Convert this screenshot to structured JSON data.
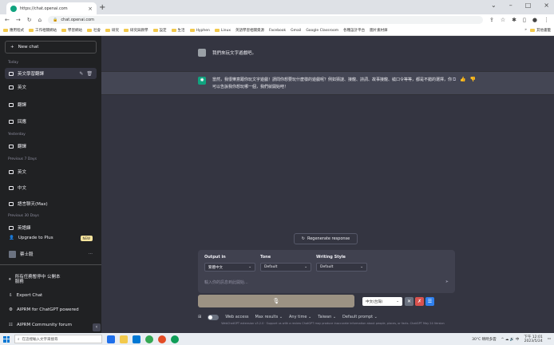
{
  "browser": {
    "tab_title": "https://chat.openai.com",
    "url": "chat.openai.com",
    "bookmarks": [
      "應用程式",
      "工作相關網站",
      "學習網站",
      "社會",
      "研究",
      "研究與教學",
      "設定",
      "生活",
      "Hyphen",
      "Linux",
      "英語學習相關資源",
      "Facebook",
      "Gmail",
      "Google Classroom",
      "各種設計平台",
      "圖片素材庫"
    ],
    "bookmarks_right": "»",
    "bookmarks_other": "其他書籤"
  },
  "sidebar": {
    "new_chat": "New chat",
    "today_label": "Today",
    "today_items": [
      "英文學習翻譯",
      "英文",
      "翻譯",
      "回應"
    ],
    "yesterday_label": "Yesterday",
    "yesterday_items": [
      "翻譯"
    ],
    "prev7_label": "Previous 7 Days",
    "prev7_items": [
      "英文",
      "中文",
      "語言聊天(Max)"
    ],
    "prev30_label": "Previous 30 Days",
    "prev30_items": [
      "英語練"
    ],
    "upgrade": "Upgrade to Plus",
    "upgrade_badge": "NEW",
    "user_name": "蔡士毅",
    "more_dots": "···",
    "footer_items": [
      "所有任務暫停中 公開本服務",
      "Export Chat",
      "AIPRM for ChatGPT powered",
      "AIPRM Community forum"
    ]
  },
  "chat": {
    "user_message": "我們來玩文字遊戲吧。",
    "ai_message": "當然，我很樂意跟你玩文字遊戲！請問你想要玩什麼樣的遊戲呢？例如猜謎、接龍、詩詞、故事接龍、繞口令等等，都是不錯的選擇，你可以告訴我你想玩哪一個，我們就開始吧！",
    "regenerate": "Regenerate response"
  },
  "options": {
    "output_label": "Output in",
    "output_value": "繁體中文",
    "tone_label": "Tone",
    "tone_value": "Default",
    "style_label": "Writing Style",
    "style_value": "Default",
    "placeholder": "輸入你的訊息到此開始..."
  },
  "controls": {
    "mic": "🎙",
    "lang": "中文(台灣)",
    "web_access": "Web access",
    "max_results": "Max results",
    "any_time": "Any time",
    "region": "Taiwan",
    "default_prompt": "Default prompt",
    "footnote": "WebChatGPT extension v3.2.0 · Support us with a review ChatGPT may produce inaccurate information about people, places, or facts. ChatGPT May 24 Version"
  },
  "taskbar": {
    "search_placeholder": "在這裡輸入文字來搜尋",
    "weather": "30°C 晴時多雲",
    "time": "下午 12:01",
    "date": "2023/5/24"
  },
  "colors": {
    "sidebar_bg": "#202123",
    "main_bg": "#343541",
    "ai_bg": "#444654",
    "accent": "#10a37f"
  }
}
